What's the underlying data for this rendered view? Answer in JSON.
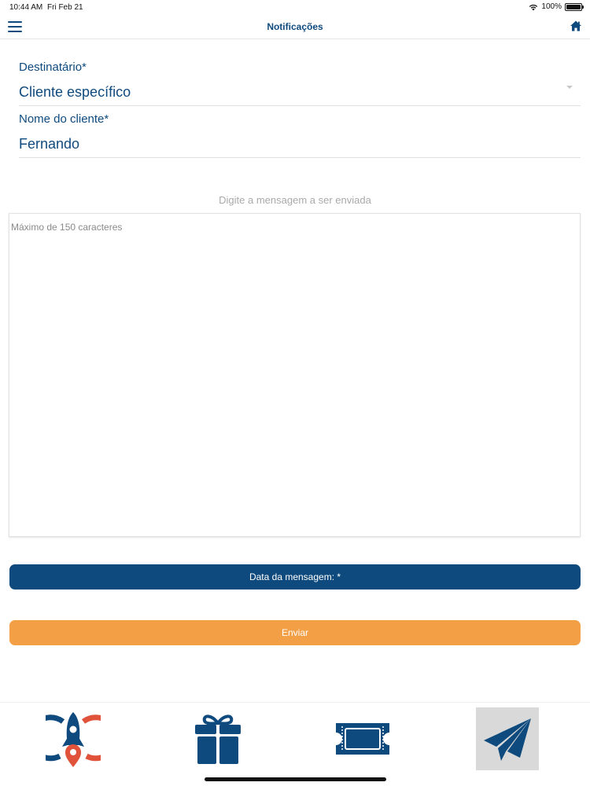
{
  "status_bar": {
    "time": "10:44 AM",
    "date": "Fri Feb 21",
    "battery": "100%",
    "icons": [
      "wifi-icon",
      "battery-icon"
    ]
  },
  "header": {
    "title": "Notificações",
    "left_icon": "menu-icon",
    "right_icon": "home-icon"
  },
  "form": {
    "recipient": {
      "label": "Destinatário*",
      "value": "Cliente específico"
    },
    "client_name": {
      "label": "Nome do cliente*",
      "value": "Fernando"
    },
    "message": {
      "hint": "Digite a mensagem a ser enviada",
      "placeholder": "Máximo de 150 caracteres"
    }
  },
  "buttons": {
    "date_label": "Data da mensagem: *",
    "send_label": "Enviar"
  },
  "tab_bar": {
    "items": [
      {
        "icon": "rocket-location-icon",
        "selected": false
      },
      {
        "icon": "gift-icon",
        "selected": false
      },
      {
        "icon": "ticket-icon",
        "selected": false
      },
      {
        "icon": "paper-plane-icon",
        "selected": true
      }
    ]
  },
  "colors": {
    "primary": "#0f4a7e",
    "accent_orange": "#f29f45",
    "accent_red": "#e0523a",
    "divider": "#e0e0e0",
    "selected_tab": "#d9d9d9"
  }
}
